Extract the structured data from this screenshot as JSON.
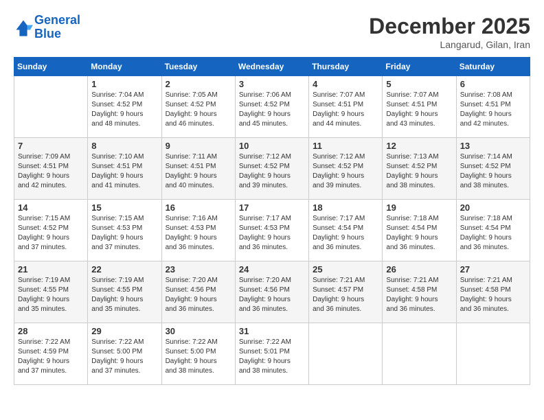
{
  "header": {
    "logo_line1": "General",
    "logo_line2": "Blue",
    "month_title": "December 2025",
    "location": "Langarud, Gilan, Iran"
  },
  "weekdays": [
    "Sunday",
    "Monday",
    "Tuesday",
    "Wednesday",
    "Thursday",
    "Friday",
    "Saturday"
  ],
  "weeks": [
    [
      {
        "day": "",
        "info": ""
      },
      {
        "day": "1",
        "info": "Sunrise: 7:04 AM\nSunset: 4:52 PM\nDaylight: 9 hours\nand 48 minutes."
      },
      {
        "day": "2",
        "info": "Sunrise: 7:05 AM\nSunset: 4:52 PM\nDaylight: 9 hours\nand 46 minutes."
      },
      {
        "day": "3",
        "info": "Sunrise: 7:06 AM\nSunset: 4:52 PM\nDaylight: 9 hours\nand 45 minutes."
      },
      {
        "day": "4",
        "info": "Sunrise: 7:07 AM\nSunset: 4:51 PM\nDaylight: 9 hours\nand 44 minutes."
      },
      {
        "day": "5",
        "info": "Sunrise: 7:07 AM\nSunset: 4:51 PM\nDaylight: 9 hours\nand 43 minutes."
      },
      {
        "day": "6",
        "info": "Sunrise: 7:08 AM\nSunset: 4:51 PM\nDaylight: 9 hours\nand 42 minutes."
      }
    ],
    [
      {
        "day": "7",
        "info": "Sunrise: 7:09 AM\nSunset: 4:51 PM\nDaylight: 9 hours\nand 42 minutes."
      },
      {
        "day": "8",
        "info": "Sunrise: 7:10 AM\nSunset: 4:51 PM\nDaylight: 9 hours\nand 41 minutes."
      },
      {
        "day": "9",
        "info": "Sunrise: 7:11 AM\nSunset: 4:51 PM\nDaylight: 9 hours\nand 40 minutes."
      },
      {
        "day": "10",
        "info": "Sunrise: 7:12 AM\nSunset: 4:52 PM\nDaylight: 9 hours\nand 39 minutes."
      },
      {
        "day": "11",
        "info": "Sunrise: 7:12 AM\nSunset: 4:52 PM\nDaylight: 9 hours\nand 39 minutes."
      },
      {
        "day": "12",
        "info": "Sunrise: 7:13 AM\nSunset: 4:52 PM\nDaylight: 9 hours\nand 38 minutes."
      },
      {
        "day": "13",
        "info": "Sunrise: 7:14 AM\nSunset: 4:52 PM\nDaylight: 9 hours\nand 38 minutes."
      }
    ],
    [
      {
        "day": "14",
        "info": "Sunrise: 7:15 AM\nSunset: 4:52 PM\nDaylight: 9 hours\nand 37 minutes."
      },
      {
        "day": "15",
        "info": "Sunrise: 7:15 AM\nSunset: 4:53 PM\nDaylight: 9 hours\nand 37 minutes."
      },
      {
        "day": "16",
        "info": "Sunrise: 7:16 AM\nSunset: 4:53 PM\nDaylight: 9 hours\nand 36 minutes."
      },
      {
        "day": "17",
        "info": "Sunrise: 7:17 AM\nSunset: 4:53 PM\nDaylight: 9 hours\nand 36 minutes."
      },
      {
        "day": "18",
        "info": "Sunrise: 7:17 AM\nSunset: 4:54 PM\nDaylight: 9 hours\nand 36 minutes."
      },
      {
        "day": "19",
        "info": "Sunrise: 7:18 AM\nSunset: 4:54 PM\nDaylight: 9 hours\nand 36 minutes."
      },
      {
        "day": "20",
        "info": "Sunrise: 7:18 AM\nSunset: 4:54 PM\nDaylight: 9 hours\nand 36 minutes."
      }
    ],
    [
      {
        "day": "21",
        "info": "Sunrise: 7:19 AM\nSunset: 4:55 PM\nDaylight: 9 hours\nand 35 minutes."
      },
      {
        "day": "22",
        "info": "Sunrise: 7:19 AM\nSunset: 4:55 PM\nDaylight: 9 hours\nand 35 minutes."
      },
      {
        "day": "23",
        "info": "Sunrise: 7:20 AM\nSunset: 4:56 PM\nDaylight: 9 hours\nand 36 minutes."
      },
      {
        "day": "24",
        "info": "Sunrise: 7:20 AM\nSunset: 4:56 PM\nDaylight: 9 hours\nand 36 minutes."
      },
      {
        "day": "25",
        "info": "Sunrise: 7:21 AM\nSunset: 4:57 PM\nDaylight: 9 hours\nand 36 minutes."
      },
      {
        "day": "26",
        "info": "Sunrise: 7:21 AM\nSunset: 4:58 PM\nDaylight: 9 hours\nand 36 minutes."
      },
      {
        "day": "27",
        "info": "Sunrise: 7:21 AM\nSunset: 4:58 PM\nDaylight: 9 hours\nand 36 minutes."
      }
    ],
    [
      {
        "day": "28",
        "info": "Sunrise: 7:22 AM\nSunset: 4:59 PM\nDaylight: 9 hours\nand 37 minutes."
      },
      {
        "day": "29",
        "info": "Sunrise: 7:22 AM\nSunset: 5:00 PM\nDaylight: 9 hours\nand 37 minutes."
      },
      {
        "day": "30",
        "info": "Sunrise: 7:22 AM\nSunset: 5:00 PM\nDaylight: 9 hours\nand 38 minutes."
      },
      {
        "day": "31",
        "info": "Sunrise: 7:22 AM\nSunset: 5:01 PM\nDaylight: 9 hours\nand 38 minutes."
      },
      {
        "day": "",
        "info": ""
      },
      {
        "day": "",
        "info": ""
      },
      {
        "day": "",
        "info": ""
      }
    ]
  ]
}
